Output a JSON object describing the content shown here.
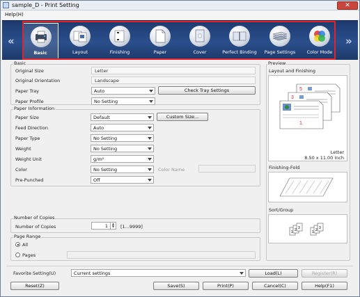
{
  "window": {
    "title": "sample_D - Print Setting",
    "close_glyph": "✕"
  },
  "menu": {
    "help": "Help(H)"
  },
  "toolbar": {
    "prev_glyph": "«",
    "next_glyph": "»",
    "tabs": [
      {
        "label": "Basic",
        "icon": "basic-icon"
      },
      {
        "label": "Layout",
        "icon": "layout-icon"
      },
      {
        "label": "Finishing",
        "icon": "finishing-icon"
      },
      {
        "label": "Paper",
        "icon": "paper-icon"
      },
      {
        "label": "Cover",
        "icon": "cover-icon"
      },
      {
        "label": "Perfect Binding",
        "icon": "perfect-binding-icon"
      },
      {
        "label": "Page Settings",
        "icon": "page-settings-icon"
      },
      {
        "label": "Color Mode",
        "icon": "color-mode-icon"
      }
    ],
    "active_tab": "Basic"
  },
  "basic": {
    "group_title": "Basic",
    "original_size_label": "Original Size",
    "original_size_value": "Letter",
    "original_orientation_label": "Original Orientation",
    "original_orientation_value": "Landscape",
    "paper_tray_label": "Paper Tray",
    "paper_tray_value": "Auto",
    "check_tray_button": "Check Tray Settings",
    "paper_profile_label": "Paper Profile",
    "paper_profile_value": "No Setting"
  },
  "paper_info": {
    "group_title": "Paper Information",
    "paper_size_label": "Paper Size",
    "paper_size_value": "Default",
    "custom_size_button": "Custom Size...",
    "feed_direction_label": "Feed Direction",
    "feed_direction_value": "Auto",
    "paper_type_label": "Paper Type",
    "paper_type_value": "No Setting",
    "weight_label": "Weight",
    "weight_value": "No Setting",
    "weight_unit_label": "Weight Unit",
    "weight_unit_value": "g/m²",
    "color_label": "Color",
    "color_value": "No Setting",
    "color_name_label": "Color Name",
    "prepunched_label": "Pre-Punched",
    "prepunched_value": "Off"
  },
  "copies": {
    "group_title": "Number of Copies",
    "label": "Number of Copies",
    "value": "1",
    "range": "[1...9999]"
  },
  "page_range": {
    "group_title": "Page Range",
    "all_label": "All",
    "pages_label": "Pages",
    "selected": "All"
  },
  "preview": {
    "group_title": "Preview",
    "layout_title": "Layout and Finishing",
    "paper_name": "Letter",
    "paper_dims": "8.50 x 11.00 inch",
    "page_numbers": [
      "5",
      "3",
      "1"
    ],
    "finishing_fold_title": "Finishing-Fold",
    "sort_group_title": "Sort/Group",
    "sort_digits": [
      "1",
      "2",
      "3",
      "1",
      "2",
      "3"
    ]
  },
  "favorite": {
    "label": "Favorite Setting(U)",
    "value": "Current settings",
    "load_button": "Load(L)",
    "register_button": "Register(R)"
  },
  "footer": {
    "reset_button": "Reset(Z)",
    "save_button": "Save(S)",
    "print_button": "Print(P)",
    "cancel_button": "Cancel(C)",
    "help_button": "Help(F1)"
  },
  "colors": {
    "toolbar": "#2b4f8c",
    "highlight": "#e3232c",
    "accent_red": "#d6252b"
  }
}
